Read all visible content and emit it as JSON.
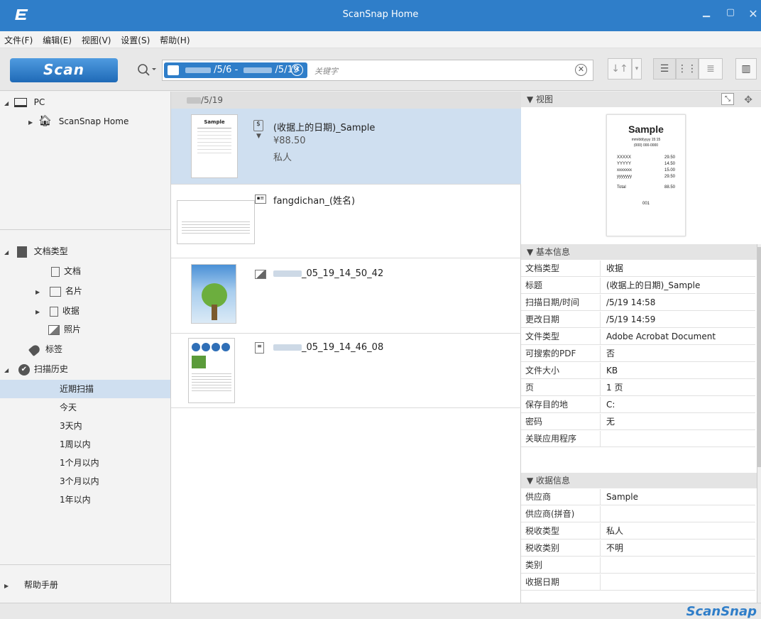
{
  "titlebar": {
    "title": "ScanSnap Home"
  },
  "menu": [
    "文件(F)",
    "编辑(E)",
    "视图(V)",
    "设置(S)",
    "帮助(H)"
  ],
  "toolbar": {
    "scan_label": "Scan",
    "date_from": "/5/6 -",
    "date_to": "/5/19",
    "keyword_placeholder": "关键字",
    "clear_symbol": "⊗",
    "sort_symbol": "↓↑",
    "sort_caret": "▾",
    "view_list_symbol": "☰",
    "view_grid_symbol": "⋮⋮",
    "view_detail_symbol": "≣",
    "panel_symbol": "▥"
  },
  "colors": {
    "accent": "#2f7ec9",
    "selected_row": "#cfdff0"
  },
  "left": {
    "pc": "PC",
    "home": "ScanSnap Home",
    "doc_type": "文档类型",
    "types": [
      "文档",
      "名片",
      "收据",
      "照片"
    ],
    "tags": "标签",
    "history": "扫描历史",
    "history_items": [
      "近期扫描",
      "今天",
      "3天内",
      "1周以内",
      "1个月以内",
      "3个月以内",
      "1年以内"
    ],
    "help": "帮助手册"
  },
  "list": {
    "date_header": "/5/19",
    "items": [
      {
        "name": "(收据上的日期)_Sample",
        "amount": "¥88.50",
        "tax": "私人",
        "icon": "receipt-icon"
      },
      {
        "name": "fangdichan_(姓名)",
        "icon": "card-icon"
      },
      {
        "name": "_05_19_14_50_42",
        "icon": "photo-icon"
      },
      {
        "name": "_05_19_14_46_08",
        "icon": "document-icon"
      }
    ]
  },
  "preview": {
    "header": "视图",
    "title": "Sample",
    "line1": "mm/dd/yyyy 15:15",
    "line2": "(000) 000-0000",
    "rows": [
      [
        "XXXXX",
        "29.50"
      ],
      [
        "YYYYY",
        "14.50"
      ],
      [
        "xxxxxxx",
        "15.00"
      ],
      [
        "yyyyyyy",
        "29.50"
      ]
    ],
    "total_label": "Total",
    "total": "88.50",
    "footer": "001"
  },
  "basic": {
    "header": "基本信息",
    "rows": [
      [
        "文档类型",
        "收据"
      ],
      [
        "标题",
        "(收据上的日期)_Sample"
      ],
      [
        "扫描日期/时间",
        "/5/19 14:58"
      ],
      [
        "更改日期",
        "/5/19 14:59"
      ],
      [
        "文件类型",
        "Adobe Acrobat Document"
      ],
      [
        "可搜索的PDF",
        "否"
      ],
      [
        "文件大小",
        "KB"
      ],
      [
        "页",
        "1 页"
      ],
      [
        "保存目的地",
        "C:"
      ],
      [
        "密码",
        "无"
      ],
      [
        "关联应用程序",
        ""
      ]
    ]
  },
  "receipt": {
    "header": "收据信息",
    "rows": [
      [
        "供应商",
        "Sample"
      ],
      [
        "供应商(拼音)",
        ""
      ],
      [
        "税收类型",
        "私人"
      ],
      [
        "税收类别",
        "不明"
      ],
      [
        "类别",
        ""
      ],
      [
        "收据日期",
        ""
      ]
    ]
  },
  "status": {
    "brand": "ScanSnap"
  }
}
